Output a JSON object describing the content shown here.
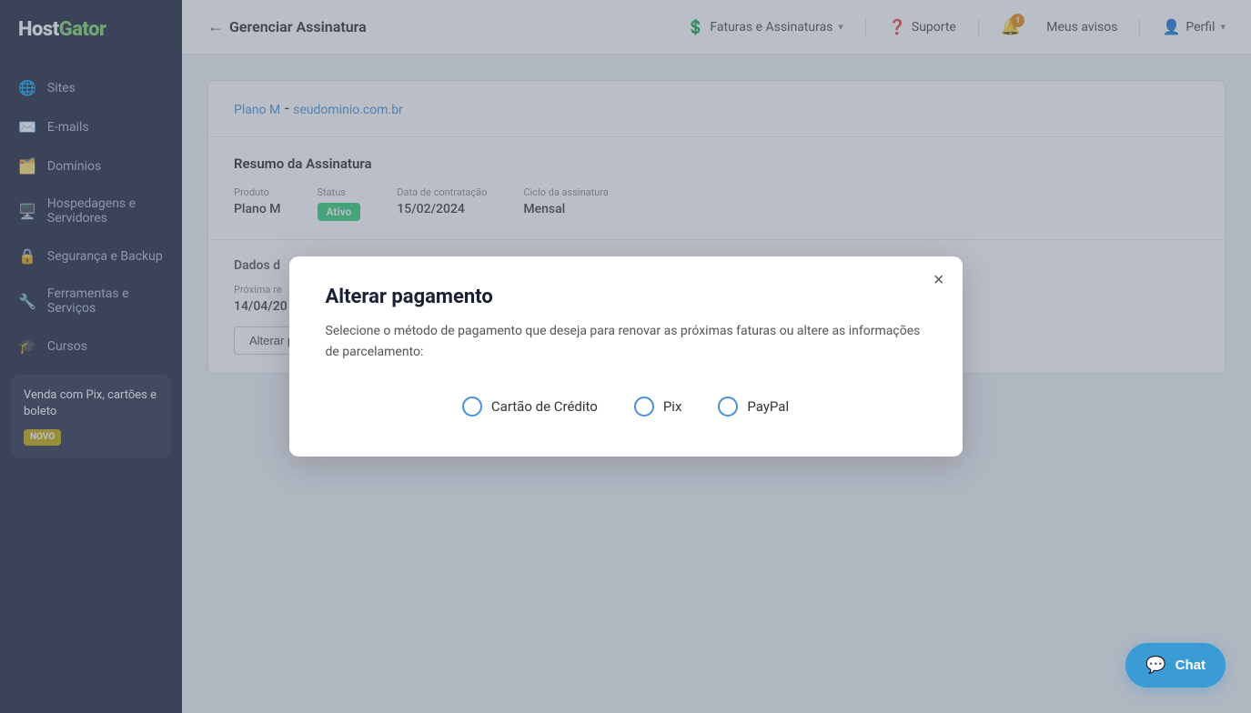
{
  "sidebar": {
    "logo": "HostGator",
    "items": [
      {
        "id": "sites",
        "label": "Sites",
        "icon": "🌐"
      },
      {
        "id": "emails",
        "label": "E-mails",
        "icon": "✉️"
      },
      {
        "id": "dominios",
        "label": "Domínios",
        "icon": "🗂️"
      },
      {
        "id": "hospedagens",
        "label": "Hospedagens e Servidores",
        "icon": "🖥️"
      },
      {
        "id": "seguranca",
        "label": "Segurança e Backup",
        "icon": "🔒"
      },
      {
        "id": "ferramentas",
        "label": "Ferramentas e Serviços",
        "icon": "🔧"
      },
      {
        "id": "cursos",
        "label": "Cursos",
        "icon": "🎓"
      }
    ],
    "promo": {
      "title": "Venda com Pix, cartões e boleto",
      "badge": "NOVO"
    }
  },
  "header": {
    "back_label": "Gerenciar Assinatura",
    "nav_faturas": "Faturas e Assinaturas",
    "nav_suporte": "Suporte",
    "nav_avisos": "Meus avisos",
    "nav_perfil": "Perfil",
    "notification_count": "1"
  },
  "page": {
    "plan_title": "Plano M",
    "plan_domain": "seudominio.com.br",
    "section_resumo": "Resumo da Assinatura",
    "label_produto": "Produto",
    "value_produto": "Plano M",
    "label_status": "Status",
    "value_status": "Ativo",
    "label_data_contratacao": "Data de contratação",
    "value_data_contratacao": "15/02/2024",
    "label_ciclo": "Ciclo da assinatura",
    "value_ciclo": "Mensal",
    "section_dados": "Dados d",
    "label_proxima": "Próxima re",
    "value_proxima": "14/04/20",
    "btn_alterar": "Alterar p"
  },
  "modal": {
    "title": "Alterar pagamento",
    "description": "Selecione o método de pagamento que deseja para renovar as próximas faturas ou altere as informações de parcelamento:",
    "options": [
      {
        "id": "cartao",
        "label": "Cartão de Crédito"
      },
      {
        "id": "pix",
        "label": "Pix"
      },
      {
        "id": "paypal",
        "label": "PayPal"
      }
    ],
    "close_label": "×"
  },
  "chat": {
    "label": "Chat"
  }
}
